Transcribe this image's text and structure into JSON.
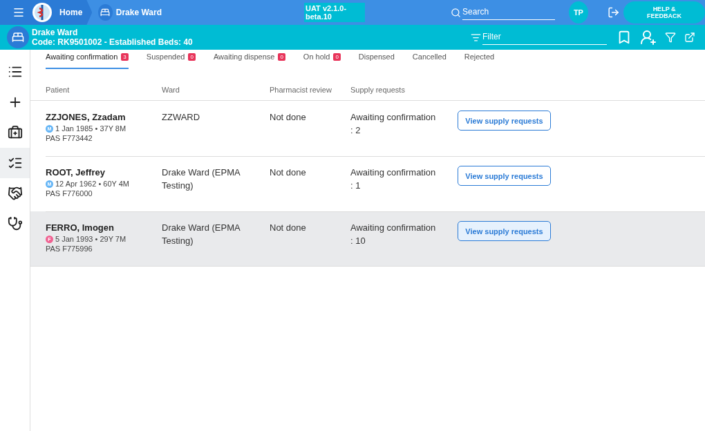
{
  "topbar": {
    "home": "Home",
    "crumb": "Drake Ward",
    "env": "UAT v2.1.0-beta.10",
    "search": {
      "placeholder": "Search"
    },
    "avatar": "TP",
    "help": "HELP & FEEDBACK"
  },
  "ward": {
    "name": "Drake Ward",
    "code": "Code: RK9501002 - Established Beds: 40",
    "filter": {
      "placeholder": "Filter"
    }
  },
  "sidebar": {
    "items": [
      {
        "kind": "list",
        "selected": false
      },
      {
        "kind": "plus",
        "selected": false
      },
      {
        "kind": "kit",
        "selected": false
      },
      {
        "kind": "checklist",
        "selected": true
      },
      {
        "kind": "handshake",
        "selected": false
      },
      {
        "kind": "stethoscope",
        "selected": false
      }
    ]
  },
  "tabs": [
    {
      "label": "Awaiting confirmation",
      "count": "3",
      "selected": true
    },
    {
      "label": "Suspended",
      "count": "0",
      "selected": false
    },
    {
      "label": "Awaiting dispense",
      "count": "0",
      "selected": false
    },
    {
      "label": "On hold",
      "count": "0",
      "selected": false
    },
    {
      "label": "Dispensed",
      "selected": false
    },
    {
      "label": "Cancelled",
      "selected": false
    },
    {
      "label": "Rejected",
      "selected": false
    }
  ],
  "table": {
    "columns": [
      "Patient",
      "Ward",
      "Pharmacist review",
      "Supply requests"
    ],
    "rows": [
      {
        "name": "ZZJONES, Zzadam",
        "sex": "M",
        "color": "#64b5f6",
        "dob": "1 Jan 1985 • 37Y 8M",
        "pas": "PAS F773442",
        "ward": "ZZWARD",
        "review": "Not done",
        "supply": "Awaiting confirmation : 2",
        "action": "View supply requests",
        "selected": false
      },
      {
        "name": "ROOT, Jeffrey",
        "sex": "M",
        "color": "#64b5f6",
        "dob": "12 Apr 1962 • 60Y 4M",
        "pas": "PAS F776000",
        "ward": "Drake Ward (EPMA Testing)",
        "review": "Not done",
        "supply": "Awaiting confirmation : 1",
        "action": "View supply requests",
        "selected": false
      },
      {
        "name": "FERRO, Imogen",
        "sex": "F",
        "color": "#f06292",
        "dob": "5 Jan 1993 • 29Y 7M",
        "pas": "PAS F775996",
        "ward": "Drake Ward (EPMA Testing)",
        "review": "Not done",
        "supply": "Awaiting confirmation : 10",
        "action": "View supply requests",
        "selected": true
      }
    ]
  }
}
